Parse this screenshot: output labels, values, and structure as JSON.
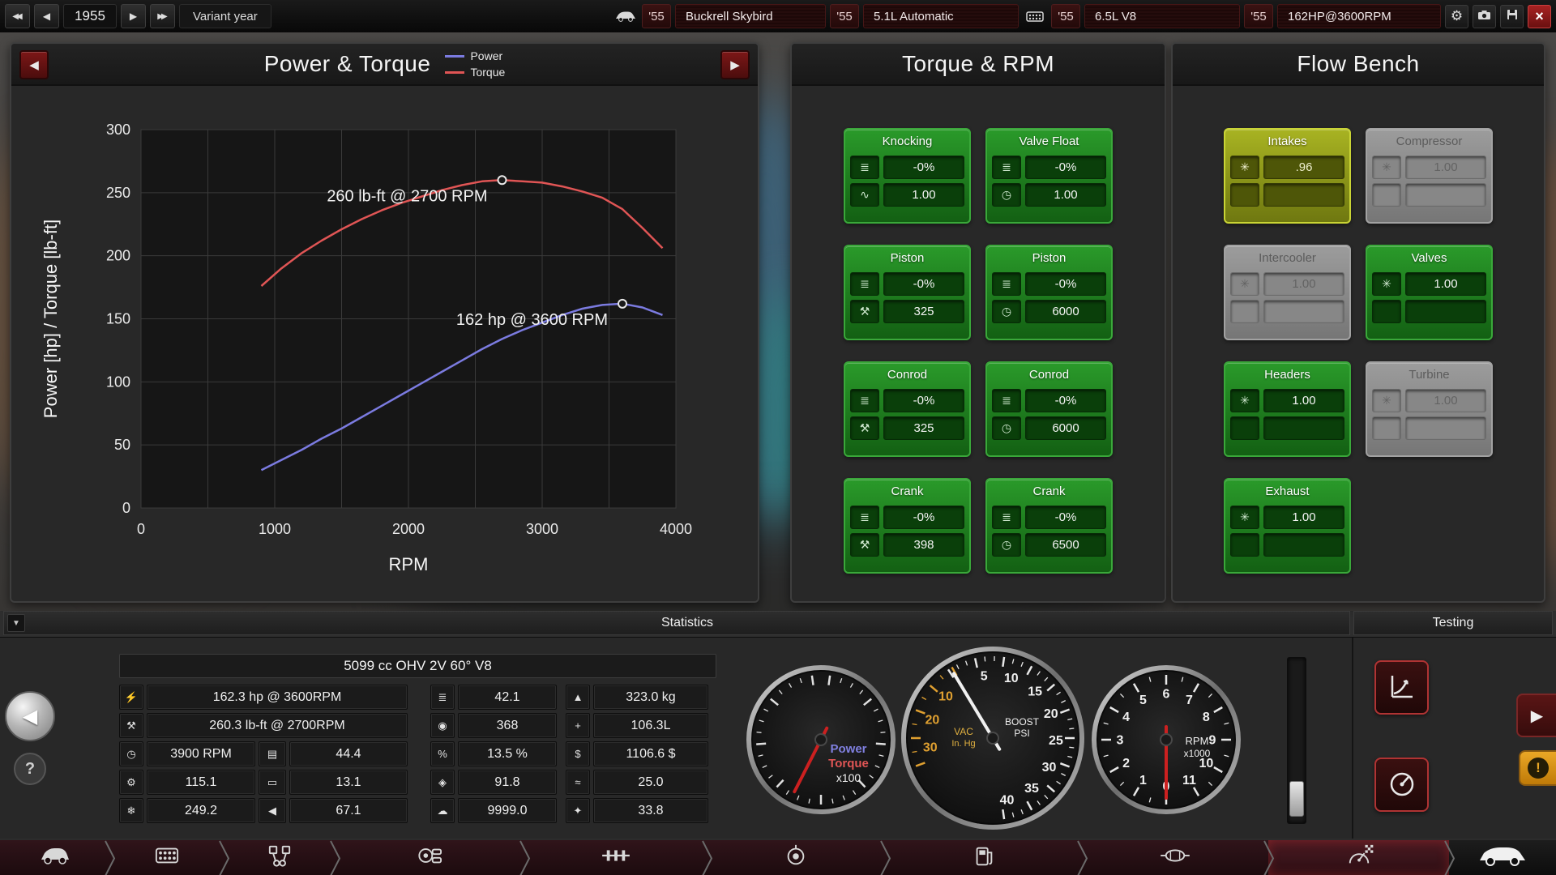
{
  "top_bar": {
    "year_value": "1955",
    "variant_year_label": "Variant year",
    "segments": [
      {
        "year": "'55",
        "name": "Buckrell Skybird"
      },
      {
        "year": "'55",
        "name": "5.1L Automatic"
      },
      {
        "year": "'55",
        "name": "6.5L V8"
      },
      {
        "year": "'55",
        "name": "162HP@3600RPM"
      }
    ]
  },
  "power_torque_panel": {
    "title": "Power & Torque",
    "legend": [
      {
        "label": "Power",
        "color": "#7b7be0"
      },
      {
        "label": "Torque",
        "color": "#e05555"
      }
    ]
  },
  "chart_data": {
    "type": "line",
    "title": "Power & Torque",
    "xlabel": "RPM",
    "ylabel": "Power [hp] / Torque [lb-ft]",
    "xlim": [
      0,
      4000
    ],
    "ylim": [
      0,
      300
    ],
    "x_ticks": [
      0,
      1000,
      2000,
      3000,
      4000
    ],
    "y_ticks": [
      0,
      50,
      100,
      150,
      200,
      250,
      300
    ],
    "x_grid_step": 500,
    "y_grid_step": 50,
    "grid": true,
    "series": [
      {
        "name": "Torque",
        "color": "#e05555",
        "points": [
          [
            900,
            176
          ],
          [
            1050,
            190
          ],
          [
            1200,
            202
          ],
          [
            1350,
            212
          ],
          [
            1500,
            221
          ],
          [
            1650,
            229
          ],
          [
            1800,
            236
          ],
          [
            1950,
            242
          ],
          [
            2100,
            247
          ],
          [
            2250,
            252
          ],
          [
            2400,
            256
          ],
          [
            2550,
            259
          ],
          [
            2700,
            260
          ],
          [
            2850,
            259
          ],
          [
            3000,
            258
          ],
          [
            3150,
            255
          ],
          [
            3300,
            251
          ],
          [
            3450,
            246
          ],
          [
            3600,
            237
          ],
          [
            3750,
            222
          ],
          [
            3900,
            206
          ]
        ]
      },
      {
        "name": "Power",
        "color": "#7b7be0",
        "points": [
          [
            900,
            30
          ],
          [
            1050,
            38
          ],
          [
            1200,
            46
          ],
          [
            1350,
            55
          ],
          [
            1500,
            63
          ],
          [
            1650,
            72
          ],
          [
            1800,
            81
          ],
          [
            1950,
            90
          ],
          [
            2100,
            99
          ],
          [
            2250,
            108
          ],
          [
            2400,
            117
          ],
          [
            2550,
            126
          ],
          [
            2700,
            134
          ],
          [
            2850,
            141
          ],
          [
            3000,
            147
          ],
          [
            3150,
            153
          ],
          [
            3300,
            158
          ],
          [
            3450,
            161
          ],
          [
            3600,
            162
          ],
          [
            3750,
            159
          ],
          [
            3900,
            153
          ]
        ]
      }
    ],
    "annotations": [
      {
        "text": "260 lb-ft @ 2700 RPM",
        "x": 2700,
        "y": 260
      },
      {
        "text": "162 hp @ 3600 RPM",
        "x": 3600,
        "y": 162
      }
    ]
  },
  "torque_rpm_panel": {
    "title": "Torque & RPM",
    "cards": [
      {
        "id": "knocking",
        "title": "Knocking",
        "rows": [
          {
            "icon": "damage-icon",
            "value": "-0%"
          },
          {
            "icon": "dyno-curve-icon",
            "value": "1.00"
          }
        ]
      },
      {
        "id": "valve-float",
        "title": "Valve Float",
        "rows": [
          {
            "icon": "damage-icon",
            "value": "-0%"
          },
          {
            "icon": "rpm-icon",
            "value": "1.00"
          }
        ]
      },
      {
        "id": "piston-torque",
        "title": "Piston",
        "rows": [
          {
            "icon": "damage-icon",
            "value": "-0%"
          },
          {
            "icon": "wrench-icon",
            "value": "325"
          }
        ]
      },
      {
        "id": "piston-rpm",
        "title": "Piston",
        "rows": [
          {
            "icon": "damage-icon",
            "value": "-0%"
          },
          {
            "icon": "rpm-icon",
            "value": "6000"
          }
        ]
      },
      {
        "id": "conrod-torque",
        "title": "Conrod",
        "rows": [
          {
            "icon": "damage-icon",
            "value": "-0%"
          },
          {
            "icon": "wrench-icon",
            "value": "325"
          }
        ]
      },
      {
        "id": "conrod-rpm",
        "title": "Conrod",
        "rows": [
          {
            "icon": "damage-icon",
            "value": "-0%"
          },
          {
            "icon": "rpm-icon",
            "value": "6000"
          }
        ]
      },
      {
        "id": "crank-torque",
        "title": "Crank",
        "rows": [
          {
            "icon": "damage-icon",
            "value": "-0%"
          },
          {
            "icon": "wrench-icon",
            "value": "398"
          }
        ]
      },
      {
        "id": "crank-rpm",
        "title": "Crank",
        "rows": [
          {
            "icon": "damage-icon",
            "value": "-0%"
          },
          {
            "icon": "rpm-icon",
            "value": "6500"
          }
        ]
      }
    ]
  },
  "flow_bench_panel": {
    "title": "Flow Bench",
    "cards": [
      {
        "id": "intakes",
        "title": "Intakes",
        "icon": "airflow-icon",
        "value": ".96",
        "state": "selected"
      },
      {
        "id": "compressor",
        "title": "Compressor",
        "icon": "airflow-icon",
        "value": "1.00",
        "state": "disabled"
      },
      {
        "id": "intercooler",
        "title": "Intercooler",
        "icon": "airflow-icon",
        "value": "1.00",
        "state": "disabled"
      },
      {
        "id": "valves",
        "title": "Valves",
        "icon": "airflow-icon",
        "value": "1.00",
        "state": "normal"
      },
      {
        "id": "headers",
        "title": "Headers",
        "icon": "airflow-icon",
        "value": "1.00",
        "state": "normal"
      },
      {
        "id": "turbine",
        "title": "Turbine",
        "icon": "airflow-icon",
        "value": "1.00",
        "state": "disabled"
      },
      {
        "id": "exhaust",
        "title": "Exhaust",
        "icon": "airflow-icon",
        "value": "1.00",
        "state": "normal"
      }
    ]
  },
  "statistics": {
    "title": "Statistics",
    "engine_name": "5099 cc OHV 2V 60° V8",
    "help_label": "?",
    "col1_wide": [
      {
        "icon": "power-icon",
        "value": "162.3 hp @ 3600RPM"
      },
      {
        "icon": "torque-icon",
        "value": "260.3 lb-ft @ 2700RPM"
      }
    ],
    "col1_left": [
      {
        "icon": "rpm-icon",
        "value": "3900 RPM"
      },
      {
        "icon": "gearbox-icon",
        "value": "115.1"
      },
      {
        "icon": "snowflake-icon",
        "value": "249.2"
      }
    ],
    "col1_right": [
      {
        "icon": "radiator-icon",
        "value": "44.4"
      },
      {
        "icon": "muffler-icon",
        "value": "13.1"
      },
      {
        "icon": "loudness-icon",
        "value": "67.1"
      }
    ],
    "col2": [
      {
        "icon": "head-icon",
        "value": "42.1"
      },
      {
        "icon": "oil-icon",
        "value": "368"
      },
      {
        "icon": "economy-icon",
        "value": "13.5 %"
      },
      {
        "icon": "fuel-icon",
        "value": "91.8"
      },
      {
        "icon": "emissions-icon",
        "value": "9999.0"
      }
    ],
    "col3": [
      {
        "icon": "weight-icon",
        "value": "323.0 kg"
      },
      {
        "icon": "size-icon",
        "value": "106.3L"
      },
      {
        "icon": "cost-icon",
        "value": "1106.6 $"
      },
      {
        "icon": "smoothness-icon",
        "value": "25.0"
      },
      {
        "icon": "service-icon",
        "value": "33.8"
      }
    ]
  },
  "testing": {
    "title": "Testing"
  },
  "gauges": [
    {
      "name": "power-torque-gauge",
      "size": 190,
      "left": 918,
      "top": 31,
      "ticks": [
        {
          "from": 8,
          "to": 352,
          "count": 32,
          "major_every": 4,
          "color": "#e0e0e0"
        }
      ],
      "numbers": [],
      "texts": [
        {
          "text": "Power",
          "dx": 34,
          "dy": 16,
          "color": "#8080e0",
          "size": 15,
          "bold": true
        },
        {
          "text": "Torque",
          "dx": 34,
          "dy": 34,
          "color": "#e05555",
          "size": 15,
          "bold": true
        },
        {
          "text": "x100",
          "dx": 34,
          "dy": 52,
          "color": "#f0f0f0",
          "size": 14
        }
      ],
      "needle": {
        "angle": 207,
        "color": "#cc2020"
      }
    },
    {
      "name": "boost-vacuum-gauge",
      "size": 232,
      "left": 1109,
      "top": 8,
      "ticks": [
        {
          "from": -33,
          "to": 172,
          "count": 30,
          "major_every": 3,
          "color": "#e8e8e8"
        },
        {
          "from": 250,
          "to": 330,
          "count": 8,
          "major_every": 2,
          "color": "#e0a030"
        }
      ],
      "numbers": [
        {
          "text": "5",
          "angle": -8,
          "color": "#f0f0f0"
        },
        {
          "text": "10",
          "angle": 17,
          "color": "#f0f0f0"
        },
        {
          "text": "15",
          "angle": 42,
          "color": "#f0f0f0"
        },
        {
          "text": "20",
          "angle": 67,
          "color": "#f0f0f0"
        },
        {
          "text": "25",
          "angle": 92,
          "color": "#f0f0f0"
        },
        {
          "text": "30",
          "angle": 117,
          "color": "#f0f0f0"
        },
        {
          "text": "35",
          "angle": 142,
          "color": "#f0f0f0"
        },
        {
          "text": "40",
          "angle": 167,
          "color": "#f0f0f0"
        },
        {
          "text": "10",
          "angle": 312,
          "color": "#e0a030"
        },
        {
          "text": "20",
          "angle": 287,
          "color": "#e0a030"
        },
        {
          "text": "30",
          "angle": 262,
          "color": "#e0a030"
        }
      ],
      "texts": [
        {
          "text": "VAC",
          "dx": -36,
          "dy": -4,
          "color": "#e0b040",
          "size": 12
        },
        {
          "text": "In. Hg",
          "dx": -36,
          "dy": 10,
          "color": "#e0b040",
          "size": 11
        },
        {
          "text": "BOOST",
          "dx": 36,
          "dy": -16,
          "color": "#f0f0f0",
          "size": 12
        },
        {
          "text": "PSI",
          "dx": 36,
          "dy": -2,
          "color": "#f0f0f0",
          "size": 12
        }
      ],
      "needle": {
        "angle": 329,
        "color": "#f0f0f0"
      }
    },
    {
      "name": "rpm-gauge",
      "size": 190,
      "left": 1344,
      "top": 31,
      "ticks": [
        {
          "from": 180,
          "to": 510,
          "count": 22,
          "major_every": 2,
          "color": "#e8e8e8"
        }
      ],
      "numbers": [
        {
          "text": "0",
          "angle": 180,
          "color": "#f0f0f0"
        },
        {
          "text": "1",
          "angle": 210,
          "color": "#f0f0f0"
        },
        {
          "text": "2",
          "angle": 240,
          "color": "#f0f0f0"
        },
        {
          "text": "3",
          "angle": 270,
          "color": "#f0f0f0"
        },
        {
          "text": "4",
          "angle": 300,
          "color": "#f0f0f0"
        },
        {
          "text": "5",
          "angle": 330,
          "color": "#f0f0f0"
        },
        {
          "text": "6",
          "angle": 360,
          "color": "#f0f0f0"
        },
        {
          "text": "7",
          "angle": 390,
          "color": "#f0f0f0"
        },
        {
          "text": "8",
          "angle": 420,
          "color": "#f0f0f0"
        },
        {
          "text": "9",
          "angle": 450,
          "color": "#f0f0f0"
        },
        {
          "text": "10",
          "angle": 480,
          "color": "#f0f0f0"
        },
        {
          "text": "11",
          "angle": 510,
          "color": "#f0f0f0"
        }
      ],
      "texts": [
        {
          "text": "RPM",
          "dx": 38,
          "dy": 6,
          "color": "#f0f0f0",
          "size": 13
        },
        {
          "text": "x1000",
          "dx": 38,
          "dy": 21,
          "color": "#f0f0f0",
          "size": 12
        }
      ],
      "needle": {
        "angle": 180,
        "color": "#cc2020"
      }
    }
  ],
  "icons": {
    "skip_back": "◀◀",
    "prev": "◀",
    "next": "▶",
    "skip_fwd": "▶▶",
    "gear": "⚙",
    "close": "×",
    "collapse": "▼",
    "back_big": "◀",
    "fwd_big": "▶",
    "damage-icon": "≣",
    "dyno-curve-icon": "∿",
    "rpm-icon": "◷",
    "wrench-icon": "⚒",
    "airflow-icon": "✳",
    "power-icon": "⚡",
    "torque-icon": "⚒",
    "gearbox-icon": "⚙",
    "snowflake-icon": "❄",
    "radiator-icon": "▤",
    "muffler-icon": "▭",
    "loudness-icon": "◀",
    "head-icon": "≣",
    "oil-icon": "◉",
    "economy-icon": "%",
    "fuel-icon": "◈",
    "emissions-icon": "☁",
    "weight-icon": "▲",
    "size-icon": "+",
    "cost-icon": "$",
    "smoothness-icon": "≈",
    "service-icon": "✦"
  }
}
